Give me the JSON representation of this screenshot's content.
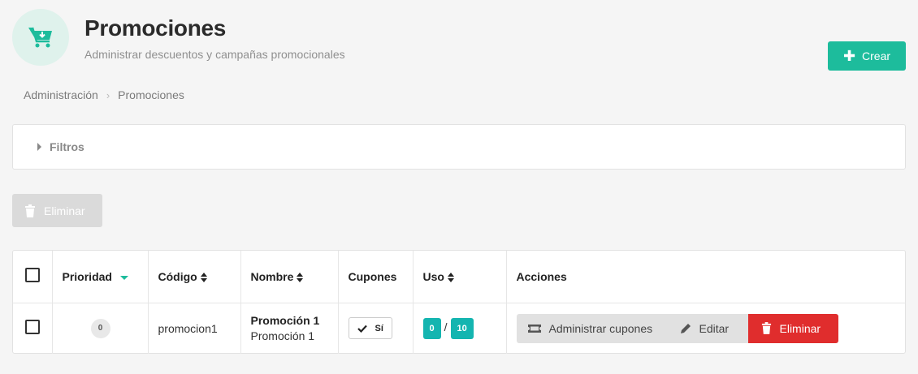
{
  "header": {
    "title": "Promociones",
    "subtitle": "Administrar descuentos y campañas promocionales",
    "icon": "cart-download-icon",
    "accent_color": "#1dbc9c"
  },
  "create_button": {
    "label": "Crear",
    "icon": "plus-icon"
  },
  "breadcrumb": {
    "items": [
      "Administración",
      "Promociones"
    ]
  },
  "filters": {
    "label": "Filtros"
  },
  "bulk_actions": {
    "delete_label": "Eliminar",
    "disabled": true
  },
  "table": {
    "columns": [
      "Prioridad",
      "Código",
      "Nombre",
      "Cupones",
      "Uso",
      "Acciones"
    ],
    "rows": [
      {
        "priority": "0",
        "code": "promocion1",
        "name": "Promoción 1",
        "name_sub": "Promoción 1",
        "coupons": "Sí",
        "usage_used": "0",
        "usage_sep": "/",
        "usage_limit": "10",
        "actions": {
          "manage_coupons": "Administrar cupones",
          "edit": "Editar",
          "delete": "Eliminar"
        }
      }
    ]
  }
}
